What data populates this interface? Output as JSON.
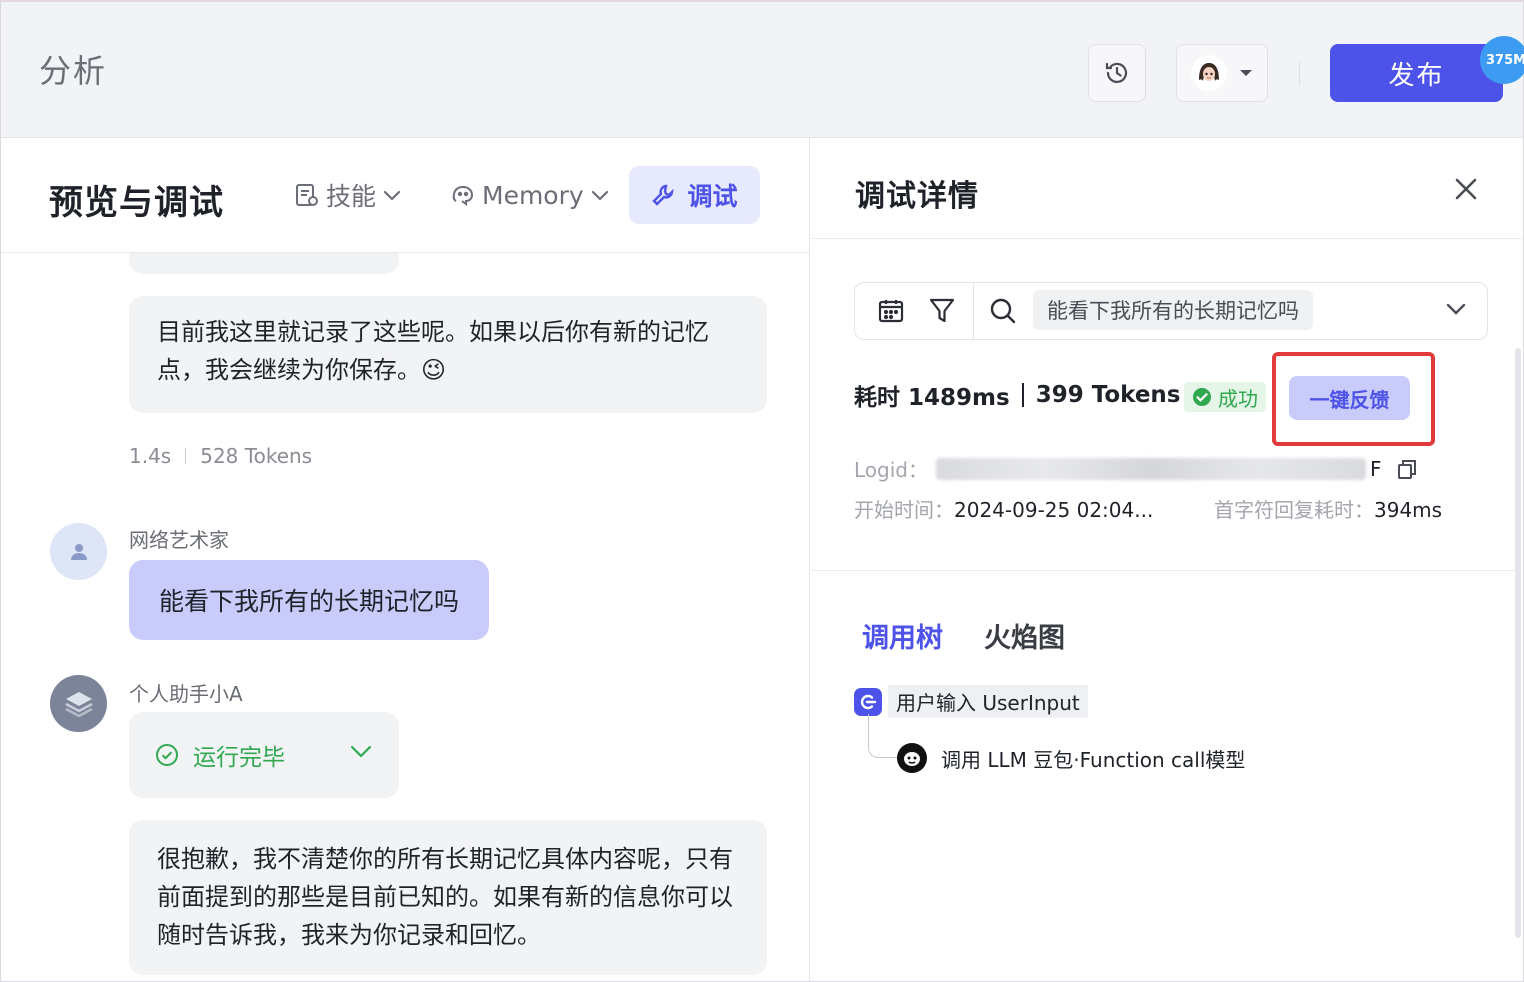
{
  "header": {
    "app_title": "分析",
    "publish_label": "发布",
    "badge_text": "375M",
    "history_icon": "clock-history-icon",
    "avatar_icon": "user-avatar-icon",
    "colors": {
      "primary": "#4d53e8",
      "badge": "#3d9bf2",
      "topbar_bg": "#f2f3f7"
    }
  },
  "preview": {
    "title": "预览与调试",
    "skills_label": "技能",
    "memory_label": "Memory",
    "debug_label": "调试"
  },
  "chat": {
    "bot_message_1": "目前我这里就记录了这些呢。如果以后你有新的记忆点，我会继续为你保存。😉",
    "meta_time": "1.4s",
    "meta_tokens": "528 Tokens",
    "user_name": "网络艺术家",
    "user_message": "能看下我所有的长期记忆吗",
    "bot_name": "个人助手小A",
    "run_status": "运行完毕",
    "bot_message_2": "很抱歉，我不清楚你的所有长期记忆具体内容呢，只有前面提到的那些是目前已知的。如果有新的信息你可以随时告诉我，我来为你记录和回忆。"
  },
  "debug": {
    "title": "调试详情",
    "query": "能看下我所有的长期记忆吗",
    "duration": "耗时 1489ms",
    "tokens": "399 Tokens",
    "status": "成功",
    "feedback_label": "一键反馈",
    "logid_label": "Logid：",
    "logid_tail": "F",
    "start_time_label": "开始时间：",
    "start_time_value": "2024-09-25 02:04...",
    "ttft_label": "首字符回复耗时：",
    "ttft_value": "394ms",
    "tabs": {
      "call_tree": "调用树",
      "flame": "火焰图"
    },
    "tree": [
      {
        "label": "用户输入 UserInput",
        "icon": "user-input-icon"
      },
      {
        "label": "调用 LLM 豆包·Function call模型",
        "icon": "llm-model-icon"
      }
    ],
    "colors": {
      "success": "#2fa84f",
      "highlight": "#e03a3a"
    }
  }
}
